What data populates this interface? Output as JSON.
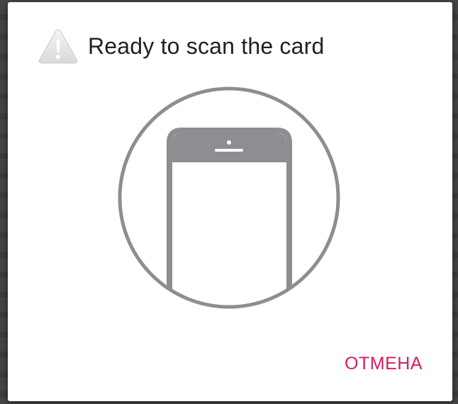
{
  "dialog": {
    "title": "Ready to scan the card",
    "title_icon": "warning-icon",
    "illustration_icon": "phone-in-circle-icon",
    "cancel_label": "ОТМЕНА"
  },
  "colors": {
    "accent": "#d81b60",
    "illustration": "#8e8d91",
    "title_text": "#212121",
    "dialog_background": "#ffffff"
  }
}
